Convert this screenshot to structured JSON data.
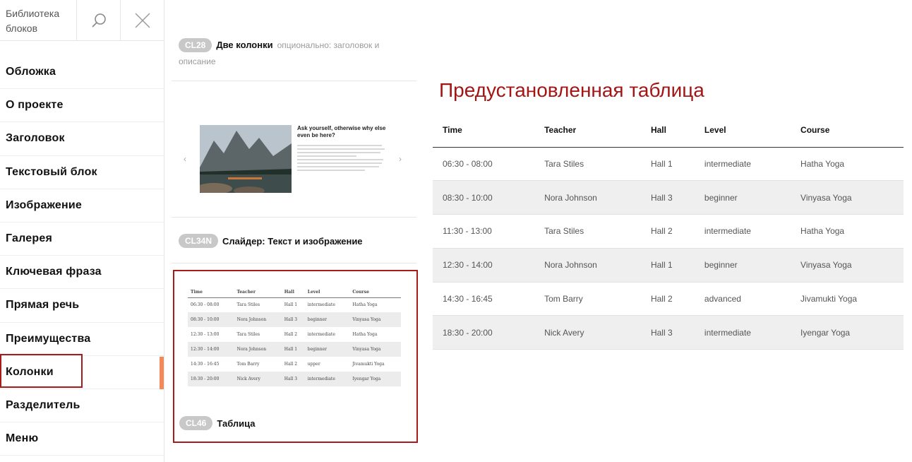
{
  "sidebar": {
    "title": "Библиотека блоков",
    "nav": [
      "Обложка",
      "О проекте",
      "Заголовок",
      "Текстовый блок",
      "Изображение",
      "Галерея",
      "Ключевая фраза",
      "Прямая речь",
      "Преимущества",
      "Колонки",
      "Разделитель",
      "Меню"
    ],
    "active": "Колонки"
  },
  "blocks": {
    "b1": {
      "code": "CL28",
      "title": "Две колонки",
      "desc": "опционально: заголовок и описание"
    },
    "b2": {
      "code": "CL34N",
      "title": "Слайдер: Текст и изображение",
      "slide_heading": "Ask yourself, otherwise why else even be here?",
      "arrow_left": "‹",
      "arrow_right": "›"
    },
    "b3": {
      "code": "CL46",
      "title": "Таблица",
      "columns": [
        "Time",
        "Teacher",
        "Hall",
        "Level",
        "Course"
      ],
      "rows": [
        [
          "06:30 - 08:00",
          "Tara Stiles",
          "Hall 1",
          "intermediate",
          "Hatha Yoga"
        ],
        [
          "08:30 - 10:00",
          "Nora Johnson",
          "Hall 3",
          "beginner",
          "Vinyasa Yoga"
        ],
        [
          "12:30 - 13:00",
          "Tara Stiles",
          "Hall 2",
          "intermediate",
          "Hatha Yoga"
        ],
        [
          "12:30 - 14:00",
          "Nora Johnson",
          "Hall 1",
          "beginner",
          "Vinyasa Yoga"
        ],
        [
          "14:30 - 16:45",
          "Tom Barry",
          "Hall 2",
          "upper",
          "Jivamukti Yoga"
        ],
        [
          "18:30 - 20:00",
          "Nick Avery",
          "Hall 3",
          "intermediate",
          "Iyengar Yoga"
        ]
      ]
    }
  },
  "main": {
    "title": "Предустановленная таблица",
    "columns": [
      "Time",
      "Teacher",
      "Hall",
      "Level",
      "Course"
    ],
    "rows": [
      [
        "06:30 - 08:00",
        "Tara Stiles",
        "Hall 1",
        "intermediate",
        "Hatha Yoga"
      ],
      [
        "08:30 - 10:00",
        "Nora Johnson",
        "Hall 3",
        "beginner",
        "Vinyasa Yoga"
      ],
      [
        "11:30 - 13:00",
        "Tara Stiles",
        "Hall 2",
        "intermediate",
        "Hatha Yoga"
      ],
      [
        "12:30 - 14:00",
        "Nora Johnson",
        "Hall 1",
        "beginner",
        "Vinyasa Yoga"
      ],
      [
        "14:30 - 16:45",
        "Tom Barry",
        "Hall 2",
        "advanced",
        "Jivamukti Yoga"
      ],
      [
        "18:30 - 20:00",
        "Nick Avery",
        "Hall 3",
        "intermediate",
        "Iyengar Yoga"
      ]
    ]
  },
  "colors": {
    "accent": "#a31616",
    "active_marker": "#f08a5d",
    "tag": "#c8c8c8"
  },
  "icons": {
    "search": "search-icon",
    "close": "close-icon"
  }
}
